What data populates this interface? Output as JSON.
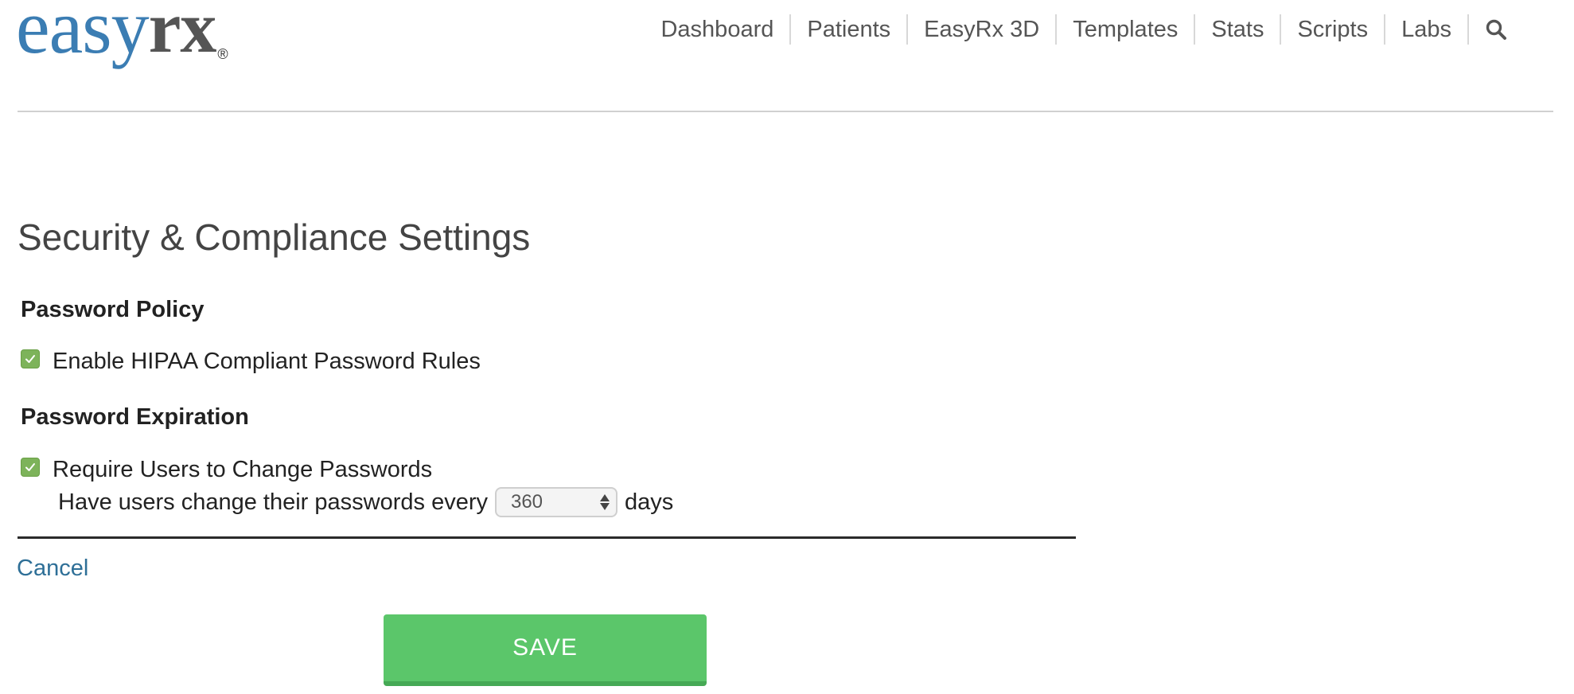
{
  "brand": {
    "logo_part1": "easy",
    "logo_part2": "rx",
    "logo_mark": "®",
    "color_blue": "#3b7db3",
    "color_gray": "#555555"
  },
  "nav": {
    "items": [
      {
        "label": "Dashboard"
      },
      {
        "label": "Patients"
      },
      {
        "label": "EasyRx 3D"
      },
      {
        "label": "Templates"
      },
      {
        "label": "Stats"
      },
      {
        "label": "Scripts"
      },
      {
        "label": "Labs"
      }
    ],
    "search_icon": "search-icon"
  },
  "main": {
    "title": "Security & Compliance Settings",
    "password_policy": {
      "heading": "Password Policy",
      "hipaa_label": "Enable HIPAA Compliant Password Rules",
      "hipaa_checked": true
    },
    "password_expiration": {
      "heading": "Password Expiration",
      "require_label": "Require Users to Change Passwords",
      "require_checked": true,
      "interval_prefix": "Have users change their passwords every",
      "interval_value": "360",
      "interval_suffix": "days"
    },
    "cancel_label": "Cancel",
    "save_label": "SAVE"
  },
  "colors": {
    "accent_green": "#5bc66a",
    "checkbox_green": "#7db35a",
    "link_blue": "#2e6f97"
  }
}
